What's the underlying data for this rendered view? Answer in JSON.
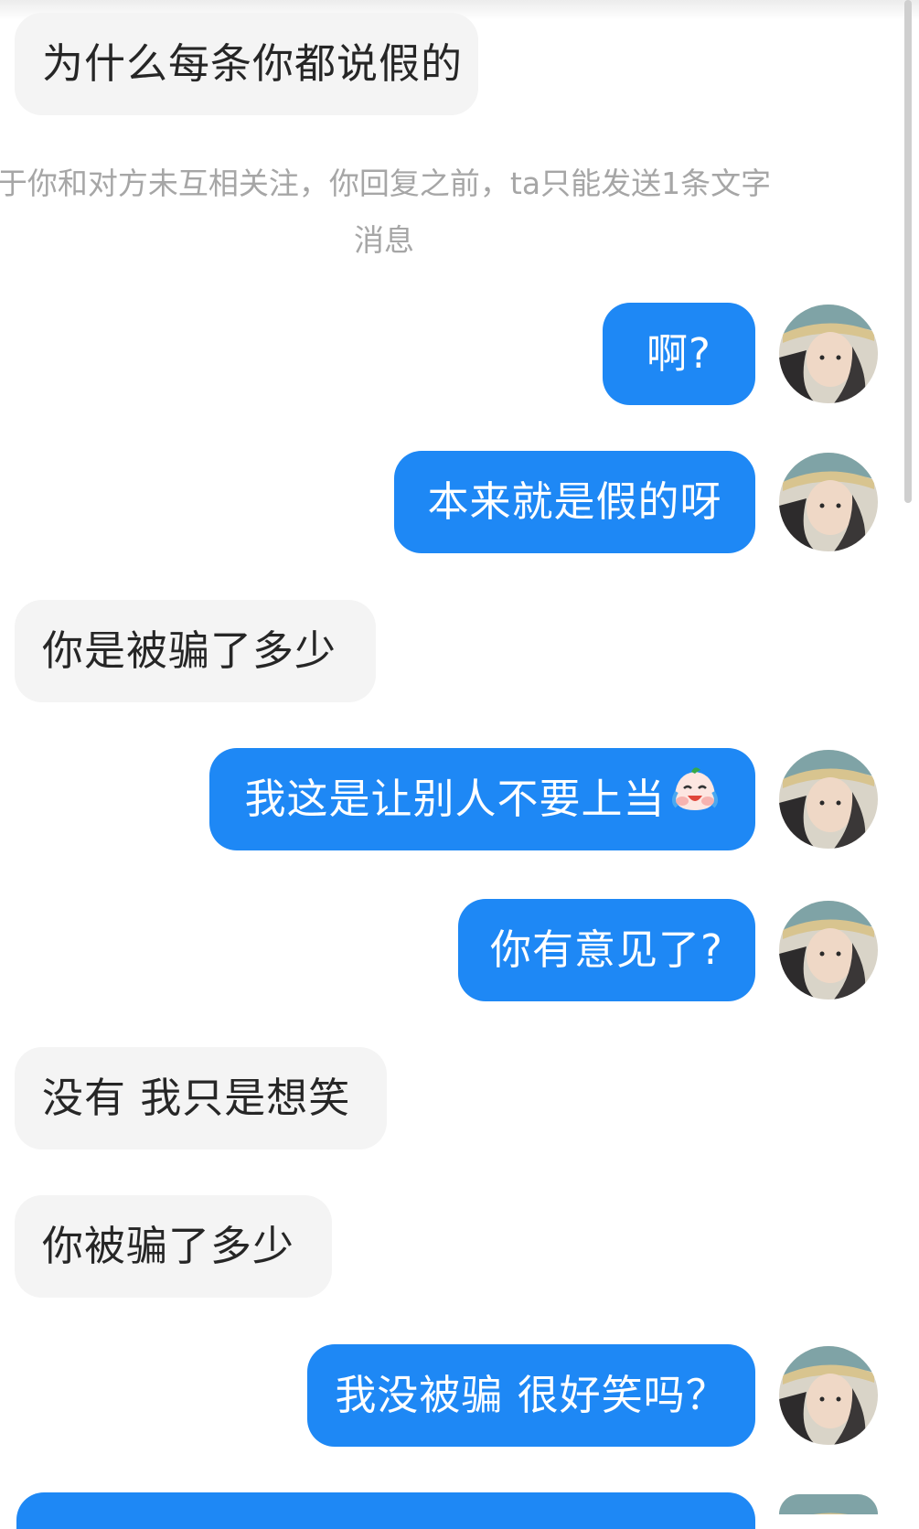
{
  "notice": {
    "line1": "于你和对方未互相关注，你回复之前，ta只能发送1条文字",
    "line2": "消息"
  },
  "messages": [
    {
      "side": "in",
      "text": "为什么每条你都说假的"
    },
    {
      "side": "out",
      "text": "啊?"
    },
    {
      "side": "out",
      "text": "本来就是假的呀"
    },
    {
      "side": "in",
      "text": "你是被骗了多少"
    },
    {
      "side": "out",
      "text": "我这是让别人不要上当",
      "emoji": "crying-laughing-emoji"
    },
    {
      "side": "out",
      "text": "你有意见了?"
    },
    {
      "side": "in",
      "text": "没有 我只是想笑"
    },
    {
      "side": "in",
      "text": "你被骗了多少"
    },
    {
      "side": "out",
      "text": "我没被骗 很好笑吗？"
    }
  ],
  "colors": {
    "outgoing_bubble": "#1e88f5",
    "incoming_bubble": "#f4f4f4",
    "notice_text": "#a6a6a6"
  }
}
